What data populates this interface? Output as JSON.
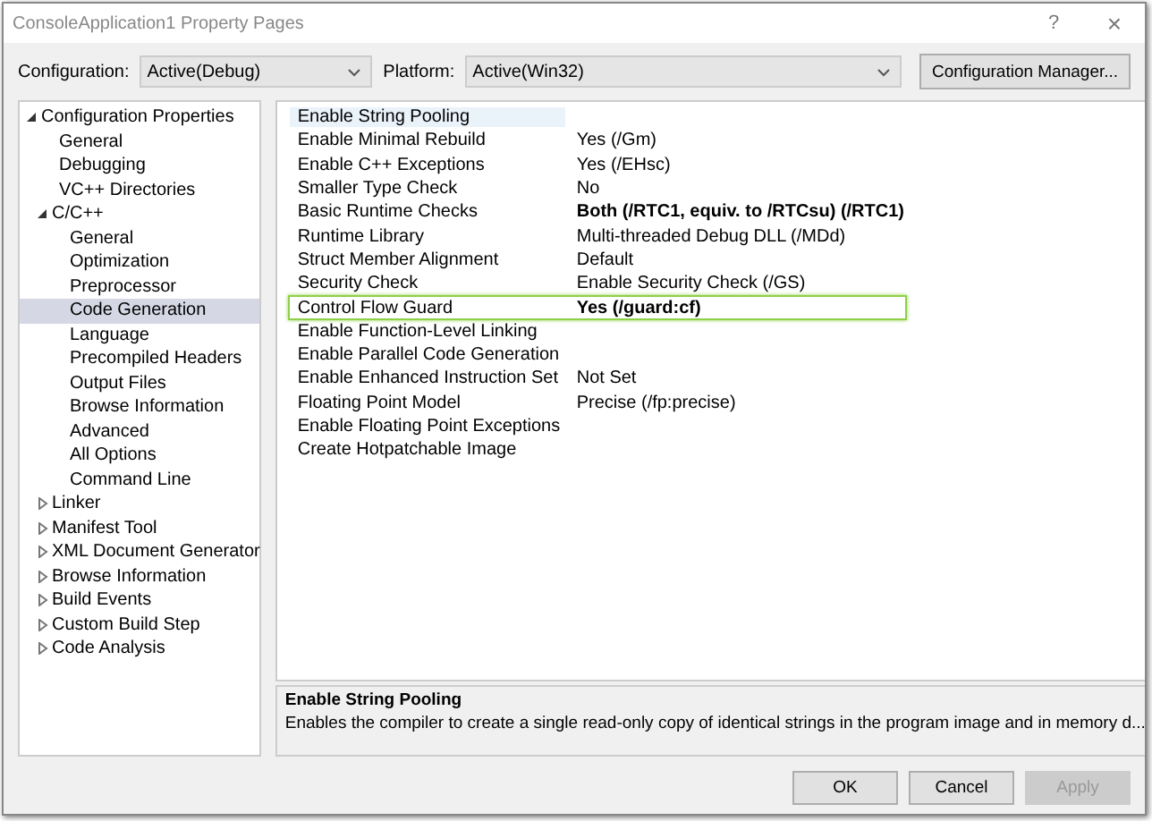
{
  "window": {
    "title": "ConsoleApplication1 Property Pages",
    "help": "?",
    "close": "×"
  },
  "configuration": {
    "label": "Configuration:",
    "value": "Active(Debug)"
  },
  "platform": {
    "label": "Platform:",
    "value": "Active(Win32)"
  },
  "configuration_manager": "Configuration Manager...",
  "tree": [
    {
      "label": "Configuration Properties",
      "expanded": true,
      "selected": false,
      "children": [
        {
          "label": "General",
          "selected": false
        },
        {
          "label": "Debugging",
          "selected": false
        },
        {
          "label": "VC++ Directories",
          "selected": false
        },
        {
          "label": "C/C++",
          "expanded": true,
          "selected": false,
          "children": [
            {
              "label": "General",
              "selected": false
            },
            {
              "label": "Optimization",
              "selected": false
            },
            {
              "label": "Preprocessor",
              "selected": false
            },
            {
              "label": "Code Generation",
              "selected": true
            },
            {
              "label": "Language",
              "selected": false
            },
            {
              "label": "Precompiled Headers",
              "selected": false
            },
            {
              "label": "Output Files",
              "selected": false
            },
            {
              "label": "Browse Information",
              "selected": false
            },
            {
              "label": "Advanced",
              "selected": false
            },
            {
              "label": "All Options",
              "selected": false
            },
            {
              "label": "Command Line",
              "selected": false
            }
          ]
        },
        {
          "label": "Linker",
          "expanded": false,
          "selected": false
        },
        {
          "label": "Manifest Tool",
          "expanded": false,
          "selected": false
        },
        {
          "label": "XML Document Generator",
          "expanded": false,
          "selected": false
        },
        {
          "label": "Browse Information",
          "expanded": false,
          "selected": false
        },
        {
          "label": "Build Events",
          "expanded": false,
          "selected": false
        },
        {
          "label": "Custom Build Step",
          "expanded": false,
          "selected": false
        },
        {
          "label": "Code Analysis",
          "expanded": false,
          "selected": false
        }
      ]
    }
  ],
  "properties": [
    {
      "name": "Enable String Pooling",
      "selected": true,
      "highlighted": false
    },
    {
      "name": "Enable Minimal Rebuild",
      "value": "Yes (/Gm)",
      "selected": false,
      "modified": false,
      "highlighted": false
    },
    {
      "name": "Enable C++ Exceptions",
      "value": "Yes (/EHsc)",
      "selected": false,
      "modified": false,
      "highlighted": false
    },
    {
      "name": "Smaller Type Check",
      "value": "No",
      "selected": false,
      "modified": false,
      "highlighted": false
    },
    {
      "name": "Basic Runtime Checks",
      "value": "Both (/RTC1, equiv. to /RTCsu) (/RTC1)",
      "selected": false,
      "modified": true,
      "highlighted": false
    },
    {
      "name": "Runtime Library",
      "value": "Multi-threaded Debug DLL (/MDd)",
      "selected": false,
      "modified": false,
      "highlighted": false
    },
    {
      "name": "Struct Member Alignment",
      "value": "Default",
      "selected": false,
      "modified": false,
      "highlighted": false
    },
    {
      "name": "Security Check",
      "value": "Enable Security Check (/GS)",
      "selected": false,
      "modified": false,
      "highlighted": false
    },
    {
      "name": "Control Flow Guard",
      "value": "Yes (/guard:cf)",
      "selected": false,
      "modified": true,
      "highlighted": true
    },
    {
      "name": "Enable Function-Level Linking",
      "selected": false,
      "highlighted": false
    },
    {
      "name": "Enable Parallel Code Generation",
      "selected": false,
      "highlighted": false
    },
    {
      "name": "Enable Enhanced Instruction Set",
      "value": "Not Set",
      "selected": false,
      "modified": false,
      "highlighted": false
    },
    {
      "name": "Floating Point Model",
      "value": "Precise (/fp:precise)",
      "selected": false,
      "modified": false,
      "highlighted": false
    },
    {
      "name": "Enable Floating Point Exceptions",
      "selected": false,
      "highlighted": false
    },
    {
      "name": "Create Hotpatchable Image",
      "selected": false,
      "highlighted": false
    }
  ],
  "description": {
    "title": "Enable String Pooling",
    "text": "Enables the compiler to create a single read-only copy of identical strings in the program image and in memory d..."
  },
  "buttons": [
    {
      "label": "OK",
      "disabled": false
    },
    {
      "label": "Cancel",
      "disabled": false
    },
    {
      "label": "Apply",
      "disabled": true
    }
  ]
}
